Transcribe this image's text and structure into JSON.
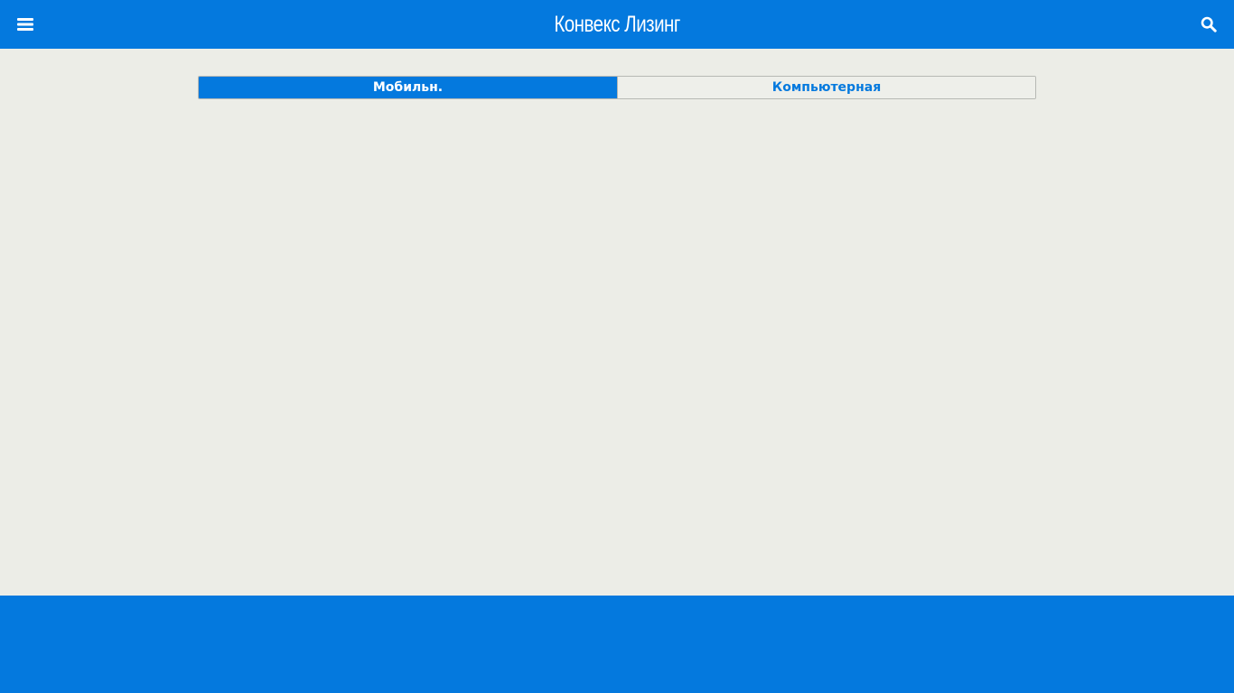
{
  "header": {
    "title": "Конвекс Лизинг",
    "menu_icon": "hamburger-menu-icon",
    "search_icon": "search-icon"
  },
  "view_toggle": {
    "options": [
      {
        "label": "Мобильн.",
        "active": true
      },
      {
        "label": "Компьютерная",
        "active": false
      }
    ]
  },
  "colors": {
    "brand_blue": "#0479de",
    "content_bg": "#ecede7",
    "white": "#ffffff"
  }
}
